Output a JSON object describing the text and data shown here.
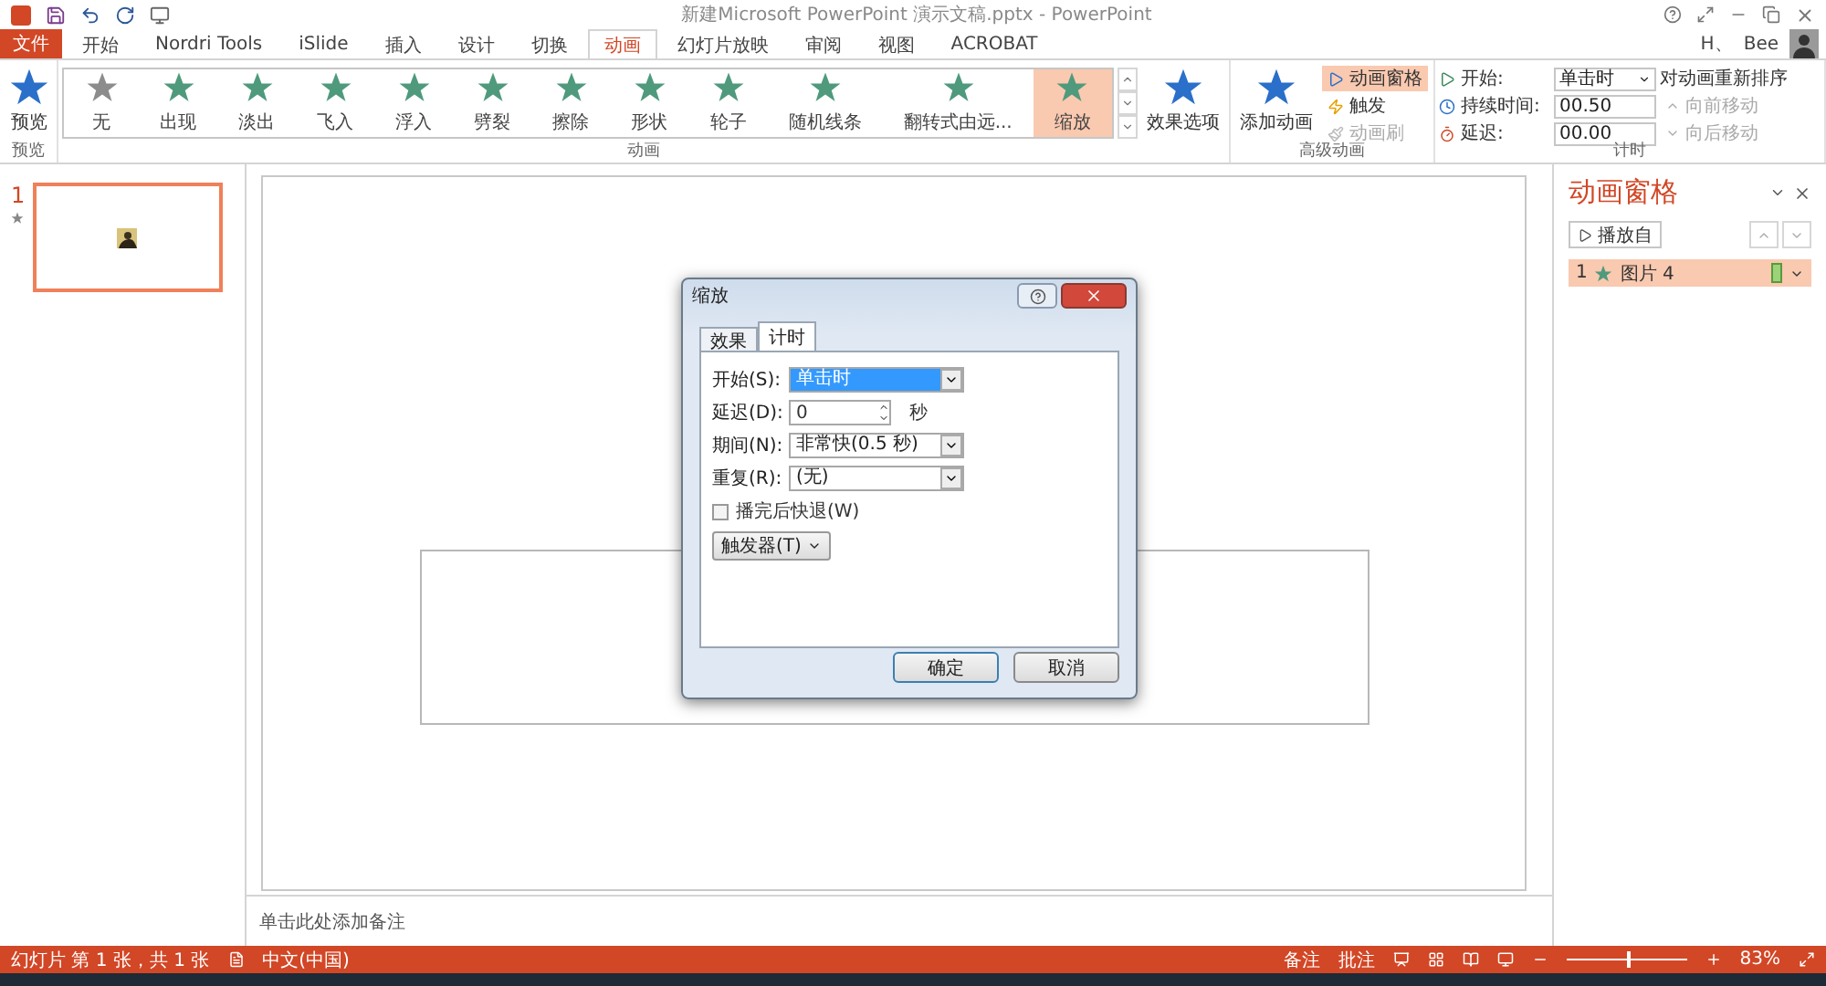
{
  "title_bar": {
    "title": "新建Microsoft PowerPoint 演示文稿.pptx - PowerPoint"
  },
  "account": {
    "initials": "H、",
    "name": "Bee"
  },
  "tabs": [
    {
      "label": "文件",
      "kind": "file",
      "selected": false
    },
    {
      "label": "开始",
      "kind": "tab",
      "selected": false
    },
    {
      "label": "Nordri Tools",
      "kind": "tab",
      "selected": false
    },
    {
      "label": "iSlide",
      "kind": "tab",
      "selected": false
    },
    {
      "label": "插入",
      "kind": "tab",
      "selected": false
    },
    {
      "label": "设计",
      "kind": "tab",
      "selected": false
    },
    {
      "label": "切换",
      "kind": "tab",
      "selected": false
    },
    {
      "label": "动画",
      "kind": "tab",
      "selected": true
    },
    {
      "label": "幻灯片放映",
      "kind": "tab",
      "selected": false
    },
    {
      "label": "审阅",
      "kind": "tab",
      "selected": false
    },
    {
      "label": "视图",
      "kind": "tab",
      "selected": false
    },
    {
      "label": "ACROBAT",
      "kind": "tab",
      "selected": false
    }
  ],
  "ribbon": {
    "preview": {
      "label": "预览",
      "group": "预览"
    },
    "gallery": {
      "group": "动画",
      "items": [
        {
          "label": "无",
          "kind": "none",
          "selected": false
        },
        {
          "label": "出现",
          "kind": "effect",
          "selected": false
        },
        {
          "label": "淡出",
          "kind": "effect",
          "selected": false
        },
        {
          "label": "飞入",
          "kind": "effect",
          "selected": false
        },
        {
          "label": "浮入",
          "kind": "effect",
          "selected": false
        },
        {
          "label": "劈裂",
          "kind": "effect",
          "selected": false
        },
        {
          "label": "擦除",
          "kind": "effect",
          "selected": false
        },
        {
          "label": "形状",
          "kind": "effect",
          "selected": false
        },
        {
          "label": "轮子",
          "kind": "effect",
          "selected": false
        },
        {
          "label": "随机线条",
          "kind": "effect",
          "selected": false
        },
        {
          "label": "翻转式由远...",
          "kind": "effect",
          "selected": false
        },
        {
          "label": "缩放",
          "kind": "effect",
          "selected": true
        }
      ]
    },
    "effect_options": "效果选项",
    "advanced": {
      "group": "高级动画",
      "add": "添加动画",
      "pane": {
        "label": "动画窗格",
        "selected": true
      },
      "trigger": {
        "label": "触发",
        "disabled": false
      },
      "painter": {
        "label": "动画刷",
        "disabled": true
      }
    },
    "timing": {
      "group": "计时",
      "start_label": "开始:",
      "start_value": "单击时",
      "duration_label": "持续时间:",
      "duration_value": "00.50",
      "delay_label": "延迟:",
      "delay_value": "00.00",
      "reorder_title": "对动画重新排序",
      "move_earlier": {
        "label": "向前移动",
        "disabled": true
      },
      "move_later": {
        "label": "向后移动",
        "disabled": true
      }
    }
  },
  "slides": [
    {
      "number": "1",
      "selected": true
    }
  ],
  "notes_placeholder": "单击此处添加备注",
  "dialog": {
    "title": "缩放",
    "tabs": [
      {
        "label": "效果",
        "selected": false
      },
      {
        "label": "计时",
        "selected": true
      }
    ],
    "fields": [
      {
        "kind": "dropdown",
        "label": "开始(S):",
        "value": "单击时",
        "focused": true
      },
      {
        "kind": "spinner",
        "label": "延迟(D):",
        "value": "0",
        "unit": "秒",
        "focused": false
      },
      {
        "kind": "dropdown",
        "label": "期间(N):",
        "value": "非常快(0.5 秒)",
        "focused": false
      },
      {
        "kind": "dropdown",
        "label": "重复(R):",
        "value": "(无)",
        "focused": false
      }
    ],
    "rewind": {
      "label": "播完后快退(W)",
      "checked": false
    },
    "triggers": "触发器(T)",
    "ok": "确定",
    "cancel": "取消"
  },
  "animation_pane": {
    "title": "动画窗格",
    "play_from": "播放自",
    "items": [
      {
        "number": "1",
        "name": "图片 4",
        "selected": true
      }
    ]
  },
  "status_bar": {
    "slide_info": "幻灯片 第 1 张，共 1 张",
    "language": "中文(中国)",
    "notes": "备注",
    "comments": "批注",
    "zoom": "83%",
    "zoom_slider": {
      "level": 0.5
    }
  }
}
